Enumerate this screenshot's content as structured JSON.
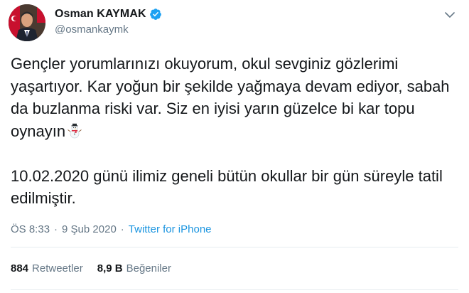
{
  "author": {
    "display_name": "Osman KAYMAK",
    "handle": "@osmankaymk",
    "verified": true,
    "avatar_icon": "profile-photo-with-flag"
  },
  "tweet": {
    "paragraph1": "Gençler yorumlarınızı okuyorum, okul sevginiz gözlerimi yaşartıyor. Kar yoğun bir şekilde yağmaya devam ediyor, sabah da buzlanma riski var. Siz en iyisi yarın güzelce bi kar topu oynayın",
    "paragraph1_emoji": "snowman-icon",
    "paragraph2": "10.02.2020 günü ilimiz geneli bütün okullar bir gün süreyle tatil edilmiştir."
  },
  "meta": {
    "time": "ÖS 8:33",
    "date": "9 Şub 2020",
    "separator": "·",
    "source": "Twitter for iPhone"
  },
  "stats": {
    "retweets_count": "884",
    "retweets_label": "Retweetler",
    "likes_count": "8,9 B",
    "likes_label": "Beğeniler"
  },
  "colors": {
    "text": "#14171a",
    "secondary": "#657786",
    "link": "#1b95e0",
    "verified": "#1da1f2",
    "divider": "#e6ecf0"
  }
}
